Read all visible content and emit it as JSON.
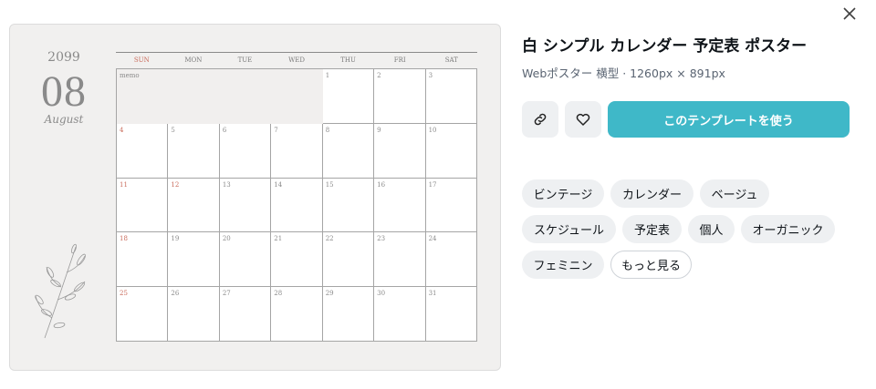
{
  "calendar": {
    "year": "2099",
    "month_number": "08",
    "month_name": "August",
    "weekdays": [
      "SUN",
      "MON",
      "TUE",
      "WED",
      "THU",
      "FRI",
      "SAT"
    ],
    "memo_label": "memo",
    "first_row_days": [
      "1",
      "2",
      "3"
    ],
    "weeks": [
      [
        "4",
        "5",
        "6",
        "7",
        "8",
        "9",
        "10"
      ],
      [
        "11",
        "12",
        "13",
        "14",
        "15",
        "16",
        "17"
      ],
      [
        "18",
        "19",
        "20",
        "21",
        "22",
        "23",
        "24"
      ],
      [
        "25",
        "26",
        "27",
        "28",
        "29",
        "30",
        "31"
      ]
    ],
    "accent_color": "#c96a5a"
  },
  "info": {
    "title": "白 シンプル カレンダー 予定表 ポスター",
    "subtitle": "Webポスター 横型 · 1260px × 891px"
  },
  "actions": {
    "link_icon": "link-icon",
    "heart_icon": "heart-icon",
    "use_template_label": "このテンプレートを使う",
    "accent_color": "#3fb8c8"
  },
  "tags": [
    "ビンテージ",
    "カレンダー",
    "ベージュ",
    "スケジュール",
    "予定表",
    "個人",
    "オーガニック",
    "フェミニン"
  ],
  "more_label": "もっと見る"
}
